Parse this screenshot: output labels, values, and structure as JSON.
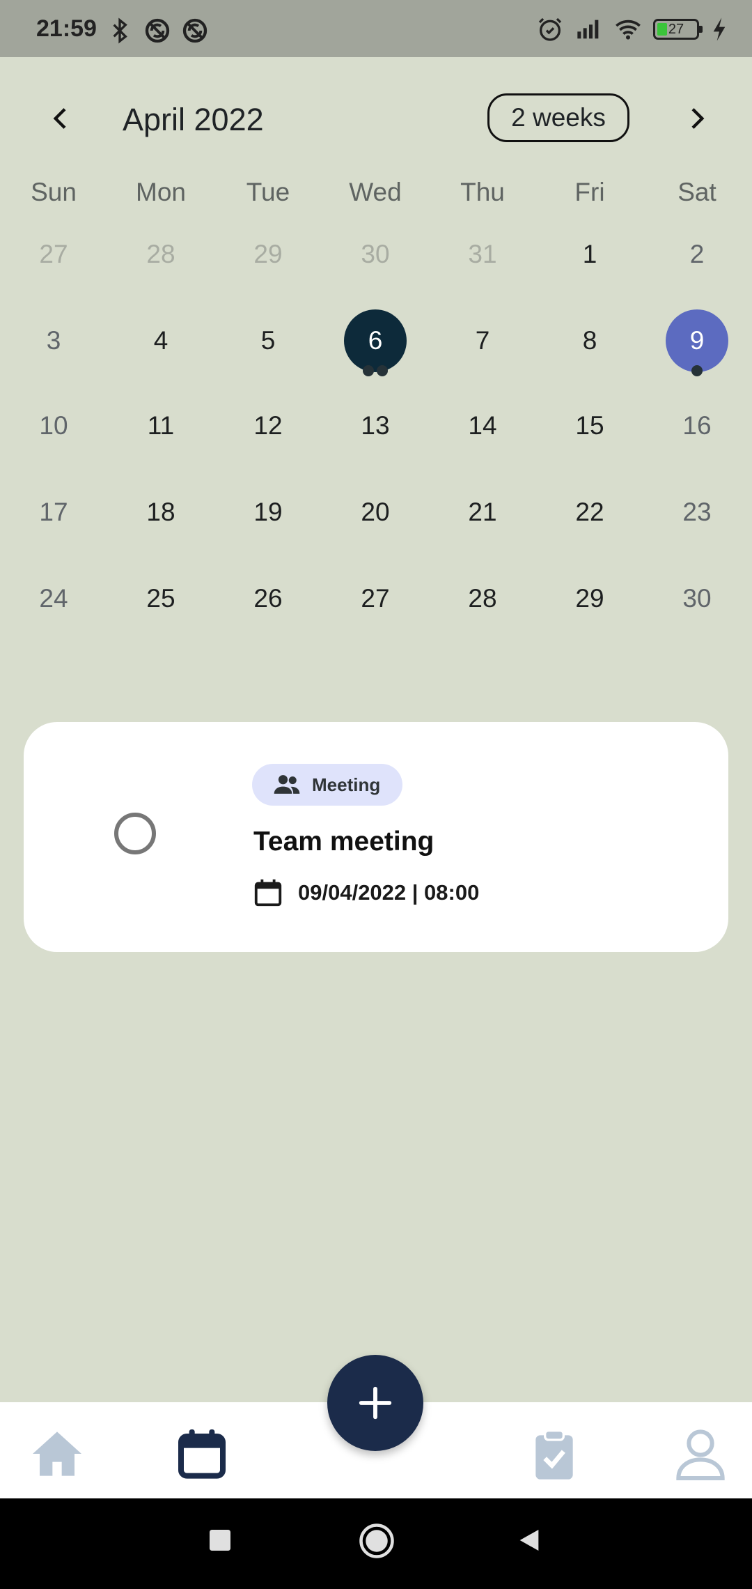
{
  "status_bar": {
    "time": "21:59",
    "battery_level": "27",
    "icons_left": [
      "bluetooth-icon",
      "sync-off-icon",
      "sync-off-icon"
    ],
    "icons_right": [
      "alarm-icon",
      "signal-icon",
      "wifi-icon",
      "battery-icon",
      "charging-icon"
    ]
  },
  "header": {
    "month_title": "April 2022",
    "range_toggle_label": "2 weeks"
  },
  "calendar": {
    "weekdays": [
      "Sun",
      "Mon",
      "Tue",
      "Wed",
      "Thu",
      "Fri",
      "Sat"
    ],
    "weeks": [
      [
        "27",
        "28",
        "29",
        "30",
        "31",
        "1",
        "2"
      ],
      [
        "3",
        "4",
        "5",
        "6",
        "7",
        "8",
        "9"
      ],
      [
        "10",
        "11",
        "12",
        "13",
        "14",
        "15",
        "16"
      ],
      [
        "17",
        "18",
        "19",
        "20",
        "21",
        "22",
        "23"
      ],
      [
        "24",
        "25",
        "26",
        "27",
        "28",
        "29",
        "30"
      ]
    ],
    "today": "6",
    "selected": "9",
    "colors": {
      "today": "#0d2a3a",
      "selected": "#5c6bc0",
      "event_dot": "#263238"
    }
  },
  "task_card": {
    "tag_label": "Meeting",
    "tag_icon": "people-icon",
    "title": "Team meeting",
    "datetime": "09/04/2022 | 08:00",
    "completed": false
  },
  "bottom_nav": {
    "items": [
      "home-icon",
      "calendar-icon",
      "clipboard-check-icon",
      "person-icon"
    ],
    "active": "calendar-icon",
    "fab_icon": "plus-icon",
    "colors": {
      "active": "#1b2b4a",
      "inactive": "#b9c7d6"
    }
  },
  "system_nav": {
    "buttons": [
      "recents-icon",
      "home-circle-icon",
      "back-icon"
    ]
  }
}
